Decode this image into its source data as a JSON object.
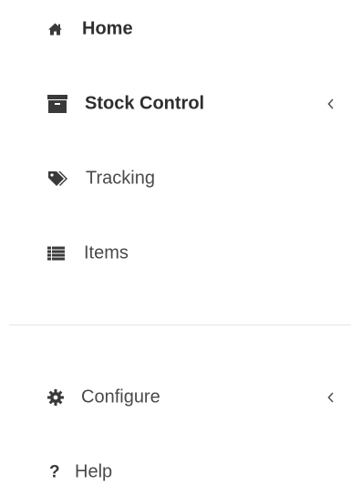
{
  "sidebar": {
    "items": [
      {
        "label": "Home",
        "icon": "home-icon"
      },
      {
        "label": "Stock Control",
        "icon": "archive-box-icon",
        "chevron": "chevron-left-icon"
      },
      {
        "label": "Tracking",
        "icon": "tags-icon"
      },
      {
        "label": "Items",
        "icon": "list-icon"
      }
    ],
    "bottom_items": [
      {
        "label": "Configure",
        "icon": "gear-icon",
        "chevron": "chevron-left-icon"
      },
      {
        "label": "Help",
        "icon": "question-icon"
      }
    ]
  }
}
